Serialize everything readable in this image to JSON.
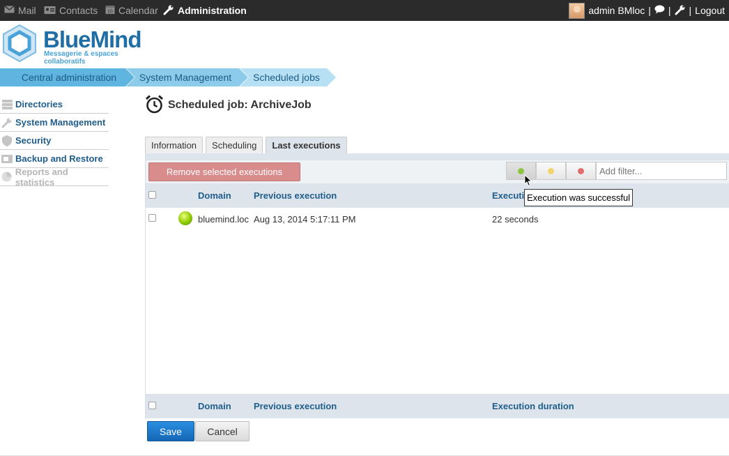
{
  "topbar": {
    "apps": [
      {
        "label": "Mail",
        "icon": "mail-icon"
      },
      {
        "label": "Contacts",
        "icon": "contacts-icon"
      },
      {
        "label": "Calendar",
        "icon": "calendar-icon"
      },
      {
        "label": "Administration",
        "icon": "wrench-icon"
      }
    ],
    "user": "admin BMloc",
    "separator": "|",
    "logout": "Logout"
  },
  "logo": {
    "brand": "BlueMind",
    "tagline": "Messagerie & espaces collaboratifs"
  },
  "breadcrumb": [
    "Central administration",
    "System Management",
    "Scheduled jobs"
  ],
  "sidebar": {
    "items": [
      {
        "label": "Directories",
        "icon": "directories-icon",
        "enabled": true
      },
      {
        "label": "System Management",
        "icon": "wrench-icon",
        "enabled": true
      },
      {
        "label": "Security",
        "icon": "shield-icon",
        "enabled": true
      },
      {
        "label": "Backup and Restore",
        "icon": "backup-icon",
        "enabled": true
      },
      {
        "label": "Reports and statistics",
        "icon": "reports-icon",
        "enabled": false
      }
    ]
  },
  "page": {
    "title": "Scheduled job: ArchiveJob"
  },
  "tabs": [
    {
      "label": "Information",
      "active": false
    },
    {
      "label": "Scheduling",
      "active": false
    },
    {
      "label": "Last executions",
      "active": true
    }
  ],
  "toolbar": {
    "remove_label": "Remove selected executions",
    "filter_placeholder": "Add filter...",
    "filters": [
      {
        "name": "success",
        "color": "#8cc63f",
        "active": true
      },
      {
        "name": "warning",
        "color": "#f2d46b",
        "active": false
      },
      {
        "name": "error",
        "color": "#e36e6e",
        "active": false
      }
    ]
  },
  "table": {
    "columns": [
      "Domain",
      "Previous execution",
      "Execution duration"
    ],
    "header_partial": "Executi",
    "rows": [
      {
        "status": "success",
        "domain": "bluemind.loc",
        "previous": "Aug 13, 2014 5:17:11 PM",
        "duration": "22 seconds"
      }
    ]
  },
  "tooltip": "Execution was successful",
  "actions": {
    "save": "Save",
    "cancel": "Cancel"
  },
  "colors": {
    "accent": "#1466b5",
    "breadcrumb": "#5bb8e3",
    "header_bg": "#dde4eb",
    "danger": "#d98c8c"
  }
}
